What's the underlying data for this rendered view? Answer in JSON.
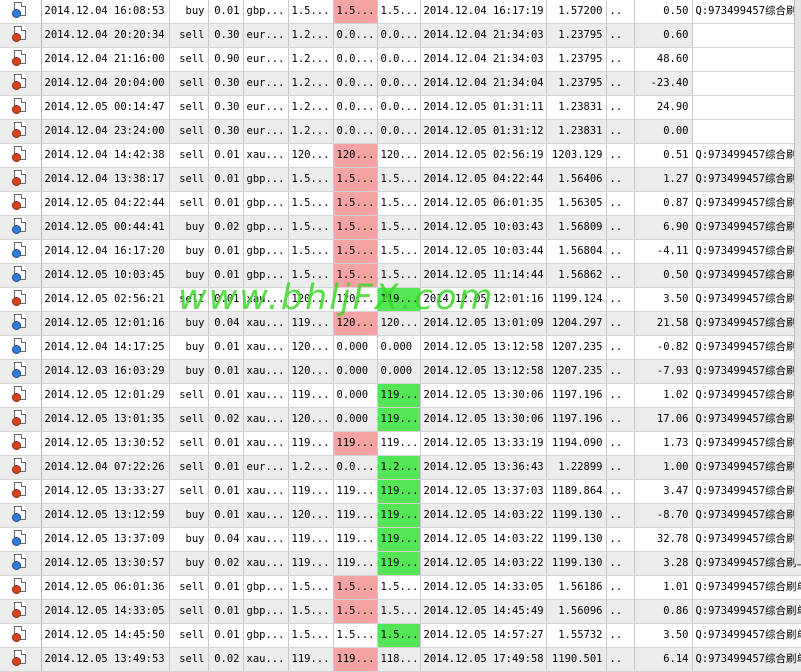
{
  "watermark": "www.bhljFX.com",
  "colors": {
    "loss_cell": "#f5a3a3",
    "profit_cell": "#55e655",
    "alt_row": "#ececec"
  },
  "rows": [
    {
      "open_time": "2014.12.04 16:08:53",
      "type": "buy",
      "size": "0.01",
      "symbol": "gbp...",
      "open_price": "1.5...",
      "sl": "1.5...",
      "tp": "1.5...",
      "close_time": "2014.12.04 16:17:19",
      "close_price": "1.57200",
      "c1": "..",
      "profit": "0.50",
      "comment": "Q:973499457综合刷单",
      "hl": "red",
      "hlcol": "sl"
    },
    {
      "open_time": "2014.12.04 20:20:34",
      "type": "sell",
      "size": "0.30",
      "symbol": "eur...",
      "open_price": "1.2...",
      "sl": "0.0...",
      "tp": "0.0...",
      "close_time": "2014.12.04 21:34:03",
      "close_price": "1.23795",
      "c1": "..",
      "profit": "0.60",
      "comment": "",
      "hl": "",
      "hlcol": ""
    },
    {
      "open_time": "2014.12.04 21:16:00",
      "type": "sell",
      "size": "0.90",
      "symbol": "eur...",
      "open_price": "1.2...",
      "sl": "0.0...",
      "tp": "0.0...",
      "close_time": "2014.12.04 21:34:03",
      "close_price": "1.23795",
      "c1": "..",
      "profit": "48.60",
      "comment": "",
      "hl": "",
      "hlcol": ""
    },
    {
      "open_time": "2014.12.04 20:04:00",
      "type": "sell",
      "size": "0.30",
      "symbol": "eur...",
      "open_price": "1.2...",
      "sl": "0.0...",
      "tp": "0.0...",
      "close_time": "2014.12.04 21:34:04",
      "close_price": "1.23795",
      "c1": "..",
      "profit": "-23.40",
      "comment": "",
      "hl": "",
      "hlcol": ""
    },
    {
      "open_time": "2014.12.05 00:14:47",
      "type": "sell",
      "size": "0.30",
      "symbol": "eur...",
      "open_price": "1.2...",
      "sl": "0.0...",
      "tp": "0.0...",
      "close_time": "2014.12.05 01:31:11",
      "close_price": "1.23831",
      "c1": "..",
      "profit": "24.90",
      "comment": "",
      "hl": "",
      "hlcol": ""
    },
    {
      "open_time": "2014.12.04 23:24:00",
      "type": "sell",
      "size": "0.30",
      "symbol": "eur...",
      "open_price": "1.2...",
      "sl": "0.0...",
      "tp": "0.0...",
      "close_time": "2014.12.05 01:31:12",
      "close_price": "1.23831",
      "c1": "..",
      "profit": "0.00",
      "comment": "",
      "hl": "",
      "hlcol": ""
    },
    {
      "open_time": "2014.12.04 14:42:38",
      "type": "sell",
      "size": "0.01",
      "symbol": "xau...",
      "open_price": "120...",
      "sl": "120...",
      "tp": "120...",
      "close_time": "2014.12.05 02:56:19",
      "close_price": "1203.129",
      "c1": "..",
      "profit": "0.51",
      "comment": "Q:973499457综合刷单",
      "hl": "red",
      "hlcol": "sl"
    },
    {
      "open_time": "2014.12.04 13:38:17",
      "type": "sell",
      "size": "0.01",
      "symbol": "gbp...",
      "open_price": "1.5...",
      "sl": "1.5...",
      "tp": "1.5...",
      "close_time": "2014.12.05 04:22:44",
      "close_price": "1.56406",
      "c1": "..",
      "profit": "1.27",
      "comment": "Q:973499457综合刷单",
      "hl": "red",
      "hlcol": "sl"
    },
    {
      "open_time": "2014.12.05 04:22:44",
      "type": "sell",
      "size": "0.01",
      "symbol": "gbp...",
      "open_price": "1.5...",
      "sl": "1.5...",
      "tp": "1.5...",
      "close_time": "2014.12.05 06:01:35",
      "close_price": "1.56305",
      "c1": "..",
      "profit": "0.87",
      "comment": "Q:973499457综合刷单",
      "hl": "red",
      "hlcol": "sl"
    },
    {
      "open_time": "2014.12.05 00:44:41",
      "type": "buy",
      "size": "0.02",
      "symbol": "gbp...",
      "open_price": "1.5...",
      "sl": "1.5...",
      "tp": "1.5...",
      "close_time": "2014.12.05 10:03:43",
      "close_price": "1.56809",
      "c1": "..",
      "profit": "6.90",
      "comment": "Q:973499457综合刷单",
      "hl": "red",
      "hlcol": "sl"
    },
    {
      "open_time": "2014.12.04 16:17:20",
      "type": "buy",
      "size": "0.01",
      "symbol": "gbp...",
      "open_price": "1.5...",
      "sl": "1.5...",
      "tp": "1.5...",
      "close_time": "2014.12.05 10:03:44",
      "close_price": "1.56804",
      "c1": "..",
      "profit": "-4.11",
      "comment": "Q:973499457综合刷单",
      "hl": "red",
      "hlcol": "sl"
    },
    {
      "open_time": "2014.12.05 10:03:45",
      "type": "buy",
      "size": "0.01",
      "symbol": "gbp...",
      "open_price": "1.5...",
      "sl": "1.5...",
      "tp": "1.5...",
      "close_time": "2014.12.05 11:14:44",
      "close_price": "1.56862",
      "c1": "..",
      "profit": "0.50",
      "comment": "Q:973499457综合刷单",
      "hl": "red",
      "hlcol": "sl"
    },
    {
      "open_time": "2014.12.05 02:56:21",
      "type": "sell",
      "size": "0.01",
      "symbol": "xau...",
      "open_price": "120...",
      "sl": "120...",
      "tp": "119...",
      "close_time": "2014.12.05 12:01:16",
      "close_price": "1199.124",
      "c1": "..",
      "profit": "3.50",
      "comment": "Q:973499457综合刷单",
      "hl": "green",
      "hlcol": "tp"
    },
    {
      "open_time": "2014.12.05 12:01:16",
      "type": "buy",
      "size": "0.04",
      "symbol": "xau...",
      "open_price": "119...",
      "sl": "120...",
      "tp": "120...",
      "close_time": "2014.12.05 13:01:09",
      "close_price": "1204.297",
      "c1": "..",
      "profit": "21.58",
      "comment": "Q:973499457综合刷单",
      "hl": "red",
      "hlcol": "sl"
    },
    {
      "open_time": "2014.12.04 14:17:25",
      "type": "buy",
      "size": "0.01",
      "symbol": "xau...",
      "open_price": "120...",
      "sl": "0.000",
      "tp": "0.000",
      "close_time": "2014.12.05 13:12:58",
      "close_price": "1207.235",
      "c1": "..",
      "profit": "-0.82",
      "comment": "Q:973499457综合刷单",
      "hl": "",
      "hlcol": ""
    },
    {
      "open_time": "2014.12.03 16:03:29",
      "type": "buy",
      "size": "0.01",
      "symbol": "xau...",
      "open_price": "120...",
      "sl": "0.000",
      "tp": "0.000",
      "close_time": "2014.12.05 13:12:58",
      "close_price": "1207.235",
      "c1": "..",
      "profit": "-7.93",
      "comment": "Q:973499457综合刷单",
      "hl": "",
      "hlcol": ""
    },
    {
      "open_time": "2014.12.05 12:01:29",
      "type": "sell",
      "size": "0.01",
      "symbol": "xau...",
      "open_price": "119...",
      "sl": "0.000",
      "tp": "119...",
      "close_time": "2014.12.05 13:30:06",
      "close_price": "1197.196",
      "c1": "..",
      "profit": "1.02",
      "comment": "Q:973499457综合刷单",
      "hl": "green",
      "hlcol": "tp"
    },
    {
      "open_time": "2014.12.05 13:01:35",
      "type": "sell",
      "size": "0.02",
      "symbol": "xau...",
      "open_price": "120...",
      "sl": "0.000",
      "tp": "119...",
      "close_time": "2014.12.05 13:30:06",
      "close_price": "1197.196",
      "c1": "..",
      "profit": "17.06",
      "comment": "Q:973499457综合刷单",
      "hl": "green",
      "hlcol": "tp"
    },
    {
      "open_time": "2014.12.05 13:30:52",
      "type": "sell",
      "size": "0.01",
      "symbol": "xau...",
      "open_price": "119...",
      "sl": "119...",
      "tp": "119...",
      "close_time": "2014.12.05 13:33:19",
      "close_price": "1194.090",
      "c1": "..",
      "profit": "1.73",
      "comment": "Q:973499457综合刷单",
      "hl": "red",
      "hlcol": "sl"
    },
    {
      "open_time": "2014.12.04 07:22:26",
      "type": "sell",
      "size": "0.01",
      "symbol": "eur...",
      "open_price": "1.2...",
      "sl": "0.0...",
      "tp": "1.2...",
      "close_time": "2014.12.05 13:36:43",
      "close_price": "1.22899",
      "c1": "..",
      "profit": "1.00",
      "comment": "Q:973499457综合刷单",
      "hl": "green",
      "hlcol": "tp"
    },
    {
      "open_time": "2014.12.05 13:33:27",
      "type": "sell",
      "size": "0.01",
      "symbol": "xau...",
      "open_price": "119...",
      "sl": "119...",
      "tp": "119...",
      "close_time": "2014.12.05 13:37:03",
      "close_price": "1189.864",
      "c1": "..",
      "profit": "3.47",
      "comment": "Q:973499457综合刷单",
      "hl": "green",
      "hlcol": "tp"
    },
    {
      "open_time": "2014.12.05 13:12:59",
      "type": "buy",
      "size": "0.01",
      "symbol": "xau...",
      "open_price": "120...",
      "sl": "119...",
      "tp": "119...",
      "close_time": "2014.12.05 14:03:22",
      "close_price": "1199.130",
      "c1": "..",
      "profit": "-8.70",
      "comment": "Q:973499457综合刷单",
      "hl": "green",
      "hlcol": "tp"
    },
    {
      "open_time": "2014.12.05 13:37:09",
      "type": "buy",
      "size": "0.04",
      "symbol": "xau...",
      "open_price": "119...",
      "sl": "119...",
      "tp": "119...",
      "close_time": "2014.12.05 14:03:22",
      "close_price": "1199.130",
      "c1": "..",
      "profit": "32.78",
      "comment": "Q:973499457综合刷单",
      "hl": "green",
      "hlcol": "tp"
    },
    {
      "open_time": "2014.12.05 13:30:57",
      "type": "buy",
      "size": "0.02",
      "symbol": "xau...",
      "open_price": "119...",
      "sl": "119...",
      "tp": "119...",
      "close_time": "2014.12.05 14:03:22",
      "close_price": "1199.130",
      "c1": "..",
      "profit": "3.28",
      "comment": "Q:973499457综合刷单",
      "hl": "green",
      "hlcol": "tp"
    },
    {
      "open_time": "2014.12.05 06:01:36",
      "type": "sell",
      "size": "0.01",
      "symbol": "gbp...",
      "open_price": "1.5...",
      "sl": "1.5...",
      "tp": "1.5...",
      "close_time": "2014.12.05 14:33:05",
      "close_price": "1.56186",
      "c1": "..",
      "profit": "1.01",
      "comment": "Q:973499457综合刷单",
      "hl": "red",
      "hlcol": "sl"
    },
    {
      "open_time": "2014.12.05 14:33:05",
      "type": "sell",
      "size": "0.01",
      "symbol": "gbp...",
      "open_price": "1.5...",
      "sl": "1.5...",
      "tp": "1.5...",
      "close_time": "2014.12.05 14:45:49",
      "close_price": "1.56096",
      "c1": "..",
      "profit": "0.86",
      "comment": "Q:973499457综合刷单",
      "hl": "red",
      "hlcol": "sl"
    },
    {
      "open_time": "2014.12.05 14:45:50",
      "type": "sell",
      "size": "0.01",
      "symbol": "gbp...",
      "open_price": "1.5...",
      "sl": "1.5...",
      "tp": "1.5...",
      "close_time": "2014.12.05 14:57:27",
      "close_price": "1.55732",
      "c1": "..",
      "profit": "3.50",
      "comment": "Q:973499457综合刷单",
      "hl": "green",
      "hlcol": "tp"
    },
    {
      "open_time": "2014.12.05 13:49:53",
      "type": "sell",
      "size": "0.02",
      "symbol": "xau...",
      "open_price": "119...",
      "sl": "119...",
      "tp": "118...",
      "close_time": "2014.12.05 17:49:58",
      "close_price": "1190.501",
      "c1": "..",
      "profit": "6.14",
      "comment": "Q:973499457综合刷单",
      "hl": "red",
      "hlcol": "sl"
    }
  ]
}
